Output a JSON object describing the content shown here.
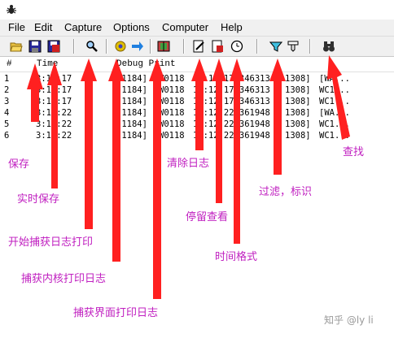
{
  "menu": [
    "File",
    "Edit",
    "Capture",
    "Options",
    "Computer",
    "Help"
  ],
  "columns": {
    "num": "#",
    "time": "Time",
    "debug": "Debug Print"
  },
  "rows": [
    {
      "num": "1",
      "time": "3:12:17",
      "pid": "[1184]",
      "src": "W0118",
      "ts": "13:12:17.346313",
      "line": "1308]",
      "msg": "[WA..."
    },
    {
      "num": "2",
      "time": "3:12:17",
      "pid": "[1184]",
      "src": "W0118",
      "ts": "13:12:17.346313",
      "line": "1308]",
      "msg": "WC1..."
    },
    {
      "num": "3",
      "time": "3:12:17",
      "pid": "[1184]",
      "src": "W0118",
      "ts": "13:12:17.346313",
      "line": "1308]",
      "msg": "WC1..."
    },
    {
      "num": "4",
      "time": "3:12:22",
      "pid": "[1184]",
      "src": "W0118",
      "ts": "13:12:22.361948",
      "line": "1308]",
      "msg": "[WA..."
    },
    {
      "num": "5",
      "time": "3:12:22",
      "pid": "[1184]",
      "src": "W0118",
      "ts": "13:12:22.361948",
      "line": "1308]",
      "msg": "WC1..."
    },
    {
      "num": "6",
      "time": "3:12:22",
      "pid": "[1184]",
      "src": "W0118",
      "ts": "13:12:22.361948",
      "line": "1308]",
      "msg": "WC1..."
    }
  ],
  "annotations": {
    "save": "保存",
    "autosave": "实时保存",
    "capture_start": "开始捕获日志打印",
    "capture_kernel": "捕获内核打印日志",
    "capture_ui": "捕获界面打印日志",
    "clear": "清除日志",
    "pause_view": "停留查看",
    "time_format": "时间格式",
    "filter": "过滤，标识",
    "find": "查找"
  },
  "watermark": "知乎 @ly li",
  "colors": {
    "annotation": "#c020c0",
    "arrow": "#ff2020"
  }
}
